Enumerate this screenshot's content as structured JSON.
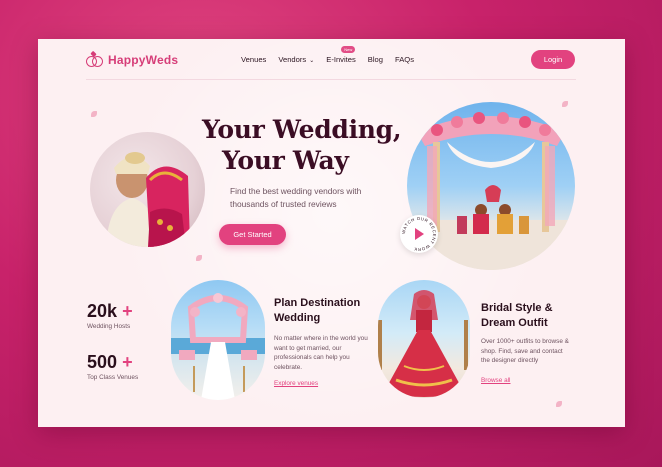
{
  "brand": {
    "name": "HappyWeds",
    "accent": "#e2427f",
    "dark": "#3b0d24"
  },
  "nav": {
    "items": [
      {
        "label": "Venues"
      },
      {
        "label": "Vendors",
        "has_dropdown": true
      },
      {
        "label": "E-Invites",
        "badge": "New"
      },
      {
        "label": "Blog"
      },
      {
        "label": "FAQs"
      }
    ],
    "login_label": "Login"
  },
  "hero": {
    "title_line1": "Your Wedding,",
    "title_line2": "Your Way",
    "subtitle": "Find the best wedding vendors with thousands of trusted reviews",
    "cta_label": "Get Started",
    "watch_text": "WATCH OUR RECENT WORK"
  },
  "stats": [
    {
      "value": "20k",
      "plus": "+",
      "label": "Wedding Hosts"
    },
    {
      "value": "500",
      "plus": "+",
      "label": "Top Class Venues"
    }
  ],
  "cards": [
    {
      "title_line1": "Plan Destination",
      "title_line2": "Wedding",
      "description": "No matter where in the world you want to get married, our professionals can help you celebrate.",
      "link": "Explore venues"
    },
    {
      "title_line1": "Bridal Style &",
      "title_line2": "Dream Outfit",
      "description": "Over 1000+ outfits to browse & shop. Find, save and contact the designer directly",
      "link": "Browse all"
    }
  ],
  "icons": [
    "rings-logo-icon",
    "chevron-down-icon",
    "play-icon",
    "petal-icon"
  ]
}
